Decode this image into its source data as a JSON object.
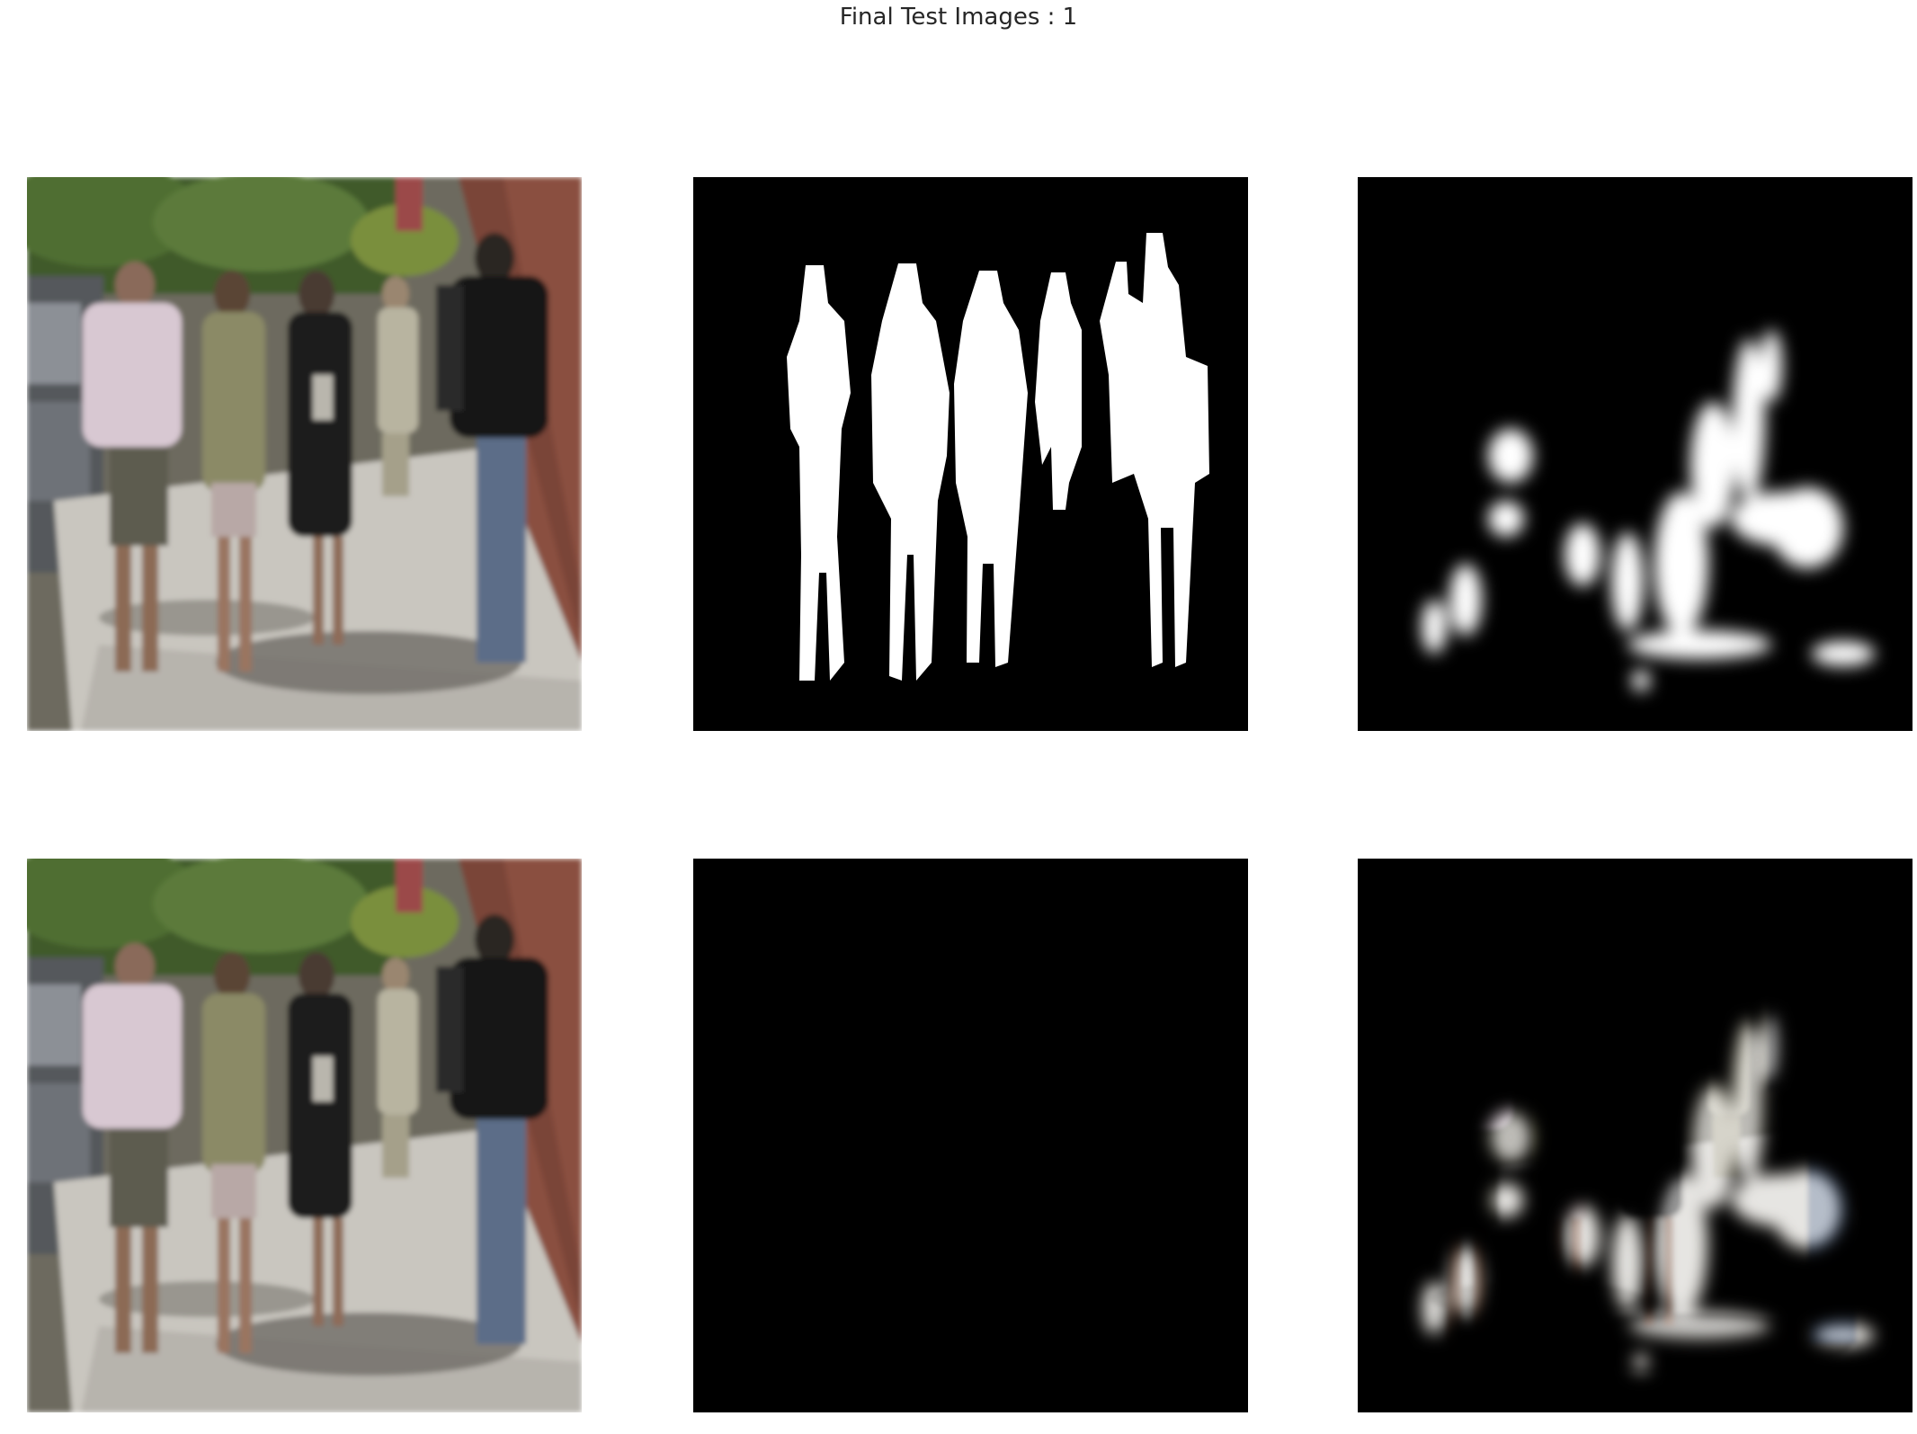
{
  "figure": {
    "title": "Final Test Images : 1"
  },
  "panels": [
    {
      "row": 1,
      "col": 1,
      "name": "input-image-top",
      "kind": "photo"
    },
    {
      "row": 1,
      "col": 2,
      "name": "ground-truth-mask",
      "kind": "binary-mask"
    },
    {
      "row": 1,
      "col": 3,
      "name": "predicted-mask",
      "kind": "soft-mask"
    },
    {
      "row": 2,
      "col": 1,
      "name": "input-image-bottom",
      "kind": "photo"
    },
    {
      "row": 2,
      "col": 2,
      "name": "ground-truth-masked-image",
      "kind": "masked-photo"
    },
    {
      "row": 2,
      "col": 3,
      "name": "predicted-masked-image",
      "kind": "masked-photo"
    }
  ],
  "colors": {
    "background": "#ffffff",
    "title_text": "#262626",
    "mask_background": "#000000",
    "mask_foreground": "#ffffff"
  }
}
